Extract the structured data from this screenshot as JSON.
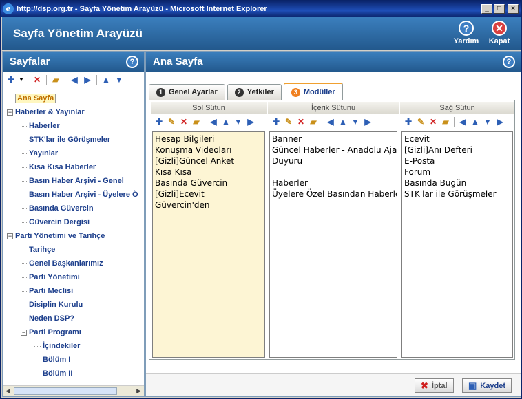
{
  "window": {
    "title": "http://dsp.org.tr - Sayfa Yönetim Arayüzü - Microsoft Internet Explorer",
    "min": "_",
    "max": "□",
    "close": "×"
  },
  "header": {
    "title": "Sayfa Yönetim Arayüzü",
    "help_label": "Yardım",
    "close_label": "Kapat",
    "help_icon": "?",
    "close_icon": "✕"
  },
  "left": {
    "title": "Sayfalar",
    "help_icon": "?"
  },
  "right": {
    "title": "Ana Sayfa",
    "help_icon": "?"
  },
  "tree": [
    {
      "label": "Ana Sayfa",
      "level": 0,
      "selected": true
    },
    {
      "label": "Haberler & Yayınlar",
      "level": 0,
      "expander": "−"
    },
    {
      "label": "Haberler",
      "level": 1
    },
    {
      "label": "STK'lar ile Görüşmeler",
      "level": 1
    },
    {
      "label": "Yayınlar",
      "level": 1
    },
    {
      "label": "Kısa Kısa Haberler",
      "level": 1
    },
    {
      "label": "Basın Haber Arşivi - Genel",
      "level": 1
    },
    {
      "label": "Basın Haber Arşivi - Üyelere Ö",
      "level": 1
    },
    {
      "label": "Basında Güvercin",
      "level": 1
    },
    {
      "label": "Güvercin Dergisi",
      "level": 1
    },
    {
      "label": "Parti Yönetimi ve Tarihçe",
      "level": 0,
      "expander": "−"
    },
    {
      "label": "Tarihçe",
      "level": 1
    },
    {
      "label": "Genel Başkanlarımız",
      "level": 1
    },
    {
      "label": "Parti Yönetimi",
      "level": 1
    },
    {
      "label": "Parti Meclisi",
      "level": 1
    },
    {
      "label": "Disiplin Kurulu",
      "level": 1
    },
    {
      "label": "Neden DSP?",
      "level": 1
    },
    {
      "label": "Parti Programı",
      "level": 1,
      "expander": "−"
    },
    {
      "label": "İçindekiler",
      "level": 2
    },
    {
      "label": "Bölüm I",
      "level": 2
    },
    {
      "label": "Bölüm II",
      "level": 2
    }
  ],
  "tabs": [
    {
      "num": "1",
      "label": "Genel Ayarlar"
    },
    {
      "num": "2",
      "label": "Yetkiler"
    },
    {
      "num": "3",
      "label": "Modüller",
      "active": true
    }
  ],
  "columns": [
    {
      "title": "Sol Sütun",
      "bg": "#fdf5d4",
      "items": [
        "Hesap Bilgileri",
        "Konuşma Videoları",
        "[Gizli]Güncel Anket",
        "Kısa Kısa",
        "Basında Güvercin",
        "[Gizli]Ecevit",
        "Güvercin'den"
      ]
    },
    {
      "title": "İçerik Sütunu",
      "bg": "#ffffff",
      "items": [
        "Banner",
        "Güncel Haberler - Anadolu Ajansı",
        "Duyuru",
        "",
        "Haberler",
        "Üyelere Özel Basından Haberler"
      ]
    },
    {
      "title": "Sağ Sütun",
      "bg": "#ffffff",
      "items": [
        "Ecevit",
        "[Gizli]Anı Defteri",
        "E-Posta",
        "Forum",
        "Basında Bugün",
        "STK'lar ile Görüşmeler"
      ]
    }
  ],
  "footer": {
    "cancel_label": "İptal",
    "save_label": "Kaydet"
  }
}
